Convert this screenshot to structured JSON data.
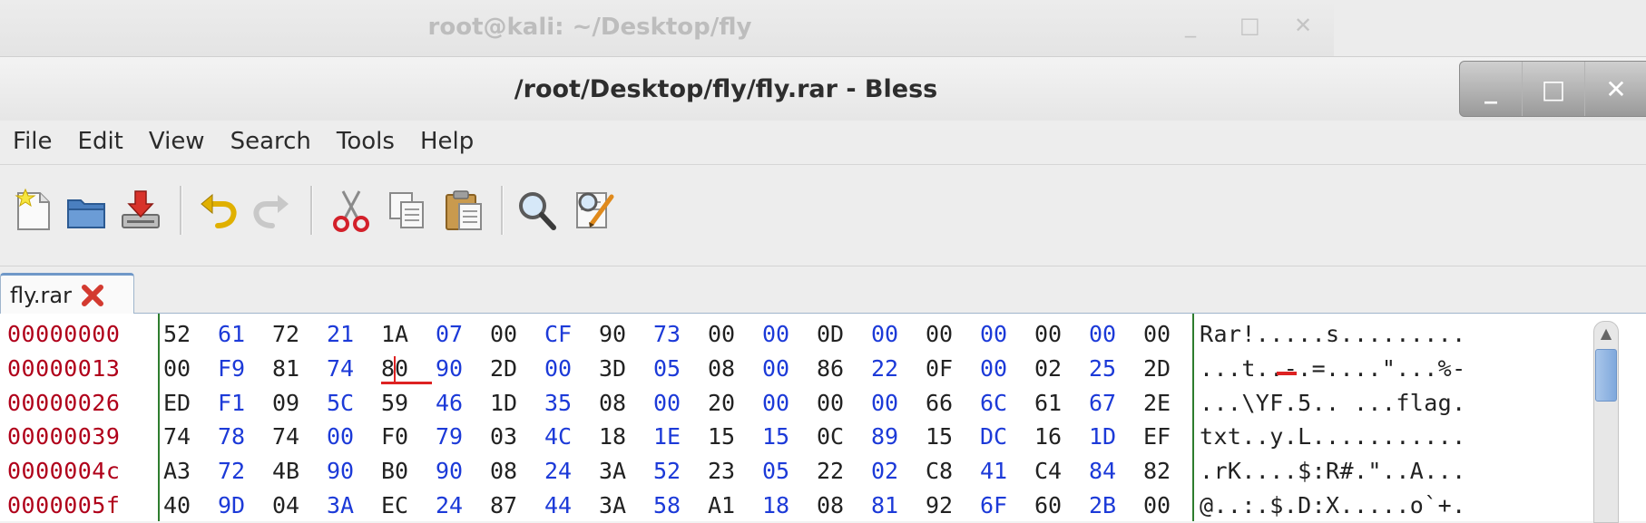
{
  "background_window": {
    "title": "root@kali: ~/Desktop/fly",
    "controls": [
      "_",
      "□",
      "✕"
    ]
  },
  "window": {
    "title": "/root/Desktop/fly/fly.rar - Bless",
    "controls": [
      "_",
      "□",
      "✕"
    ]
  },
  "menu": [
    "File",
    "Edit",
    "View",
    "Search",
    "Tools",
    "Help"
  ],
  "toolbar": {
    "icons": [
      "new-document-icon",
      "open-folder-icon",
      "save-icon",
      "undo-icon",
      "redo-icon",
      "cut-icon",
      "copy-icon",
      "paste-icon",
      "find-icon",
      "replace-icon"
    ]
  },
  "tab": {
    "label": "fly.rar"
  },
  "colors": {
    "offset": "#b0001a",
    "hex_odd": "#1c3ad8",
    "hex_even": "#222222",
    "divider": "#2e7d2e",
    "cursor": "#d22222"
  },
  "editor": {
    "offsets": [
      "00000000",
      "00000013",
      "00000026",
      "00000039",
      "0000004c",
      "0000005f"
    ],
    "hex_rows": [
      [
        "52",
        "61",
        "72",
        "21",
        "1A",
        "07",
        "00",
        "CF",
        "90",
        "73",
        "00",
        "00",
        "0D",
        "00",
        "00",
        "00",
        "00",
        "00",
        "00"
      ],
      [
        "00",
        "F9",
        "81",
        "74",
        "80",
        "90",
        "2D",
        "00",
        "3D",
        "05",
        "08",
        "00",
        "86",
        "22",
        "0F",
        "00",
        "02",
        "25",
        "2D"
      ],
      [
        "ED",
        "F1",
        "09",
        "5C",
        "59",
        "46",
        "1D",
        "35",
        "08",
        "00",
        "20",
        "00",
        "00",
        "00",
        "66",
        "6C",
        "61",
        "67",
        "2E"
      ],
      [
        "74",
        "78",
        "74",
        "00",
        "F0",
        "79",
        "03",
        "4C",
        "18",
        "1E",
        "15",
        "15",
        "0C",
        "89",
        "15",
        "DC",
        "16",
        "1D",
        "EF"
      ],
      [
        "A3",
        "72",
        "4B",
        "90",
        "B0",
        "90",
        "08",
        "24",
        "3A",
        "52",
        "23",
        "05",
        "22",
        "02",
        "C8",
        "41",
        "C4",
        "84",
        "82"
      ],
      [
        "40",
        "9D",
        "04",
        "3A",
        "EC",
        "24",
        "87",
        "44",
        "3A",
        "58",
        "A1",
        "18",
        "08",
        "81",
        "92",
        "6F",
        "60",
        "2B",
        "00"
      ]
    ],
    "ascii_rows": [
      "Rar!.....s.........",
      "...t..-.=....\"...%-",
      "...\\YF.5.. ...flag.",
      "txt..y.L...........",
      ".rK....$:R#.\"..A...",
      "@..:.$.D:X.....o`+."
    ],
    "cursor": {
      "row": 1,
      "column": 4
    }
  }
}
